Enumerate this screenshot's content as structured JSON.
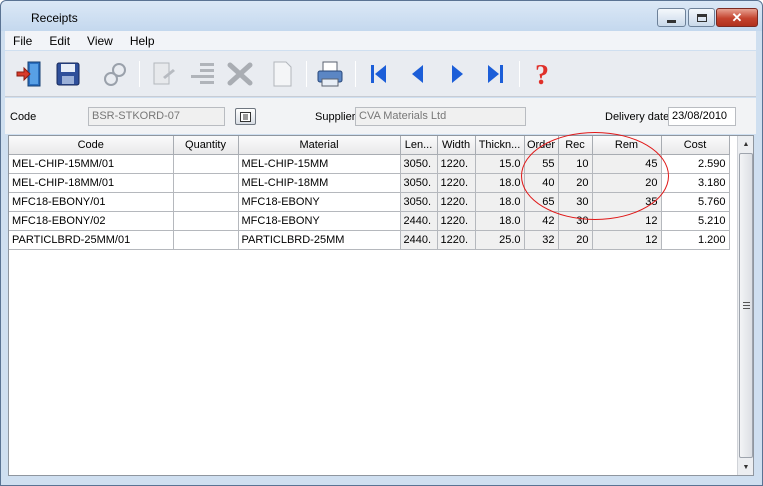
{
  "window": {
    "title": "Receipts"
  },
  "menu": [
    "File",
    "Edit",
    "View",
    "Help"
  ],
  "toolbar": {
    "icons": [
      "exit-icon",
      "save-icon",
      "find-icon",
      "edit-icon",
      "list-icon",
      "delete-icon",
      "new-icon",
      "print-icon",
      "first-record-icon",
      "previous-record-icon",
      "next-record-icon",
      "last-record-icon",
      "help-icon"
    ]
  },
  "form": {
    "code_label": "Code",
    "code_value": "BSR-STKORD-07",
    "supplier_label": "Supplier",
    "supplier_value": "CVA Materials Ltd",
    "delivery_label": "Delivery date",
    "delivery_value": "23/08/2010"
  },
  "grid": {
    "columns": [
      "Code",
      "Quantity",
      "Material",
      "Len...",
      "Width",
      "Thickn...",
      "Order",
      "Rec",
      "Rem",
      "Cost"
    ],
    "rows": [
      [
        "MEL-CHIP-15MM/01",
        "",
        "MEL-CHIP-15MM",
        "3050.",
        "1220.",
        "15.0",
        "55",
        "10",
        "45",
        "2.590"
      ],
      [
        "MEL-CHIP-18MM/01",
        "",
        "MEL-CHIP-18MM",
        "3050.",
        "1220.",
        "18.0",
        "40",
        "20",
        "20",
        "3.180"
      ],
      [
        "MFC18-EBONY/01",
        "",
        "MFC18-EBONY",
        "3050.",
        "1220.",
        "18.0",
        "65",
        "30",
        "35",
        "5.760"
      ],
      [
        "MFC18-EBONY/02",
        "",
        "MFC18-EBONY",
        "2440.",
        "1220.",
        "18.0",
        "42",
        "30",
        "12",
        "5.210"
      ],
      [
        "PARTICLBRD-25MM/01",
        "",
        "PARTICLBRD-25MM",
        "2440.",
        "1220.",
        "25.0",
        "32",
        "20",
        "12",
        "1.200"
      ]
    ]
  },
  "colors": {
    "annotation": "#e01818",
    "titlebar": "#c4d8ee",
    "close_button": "#c4432e"
  }
}
